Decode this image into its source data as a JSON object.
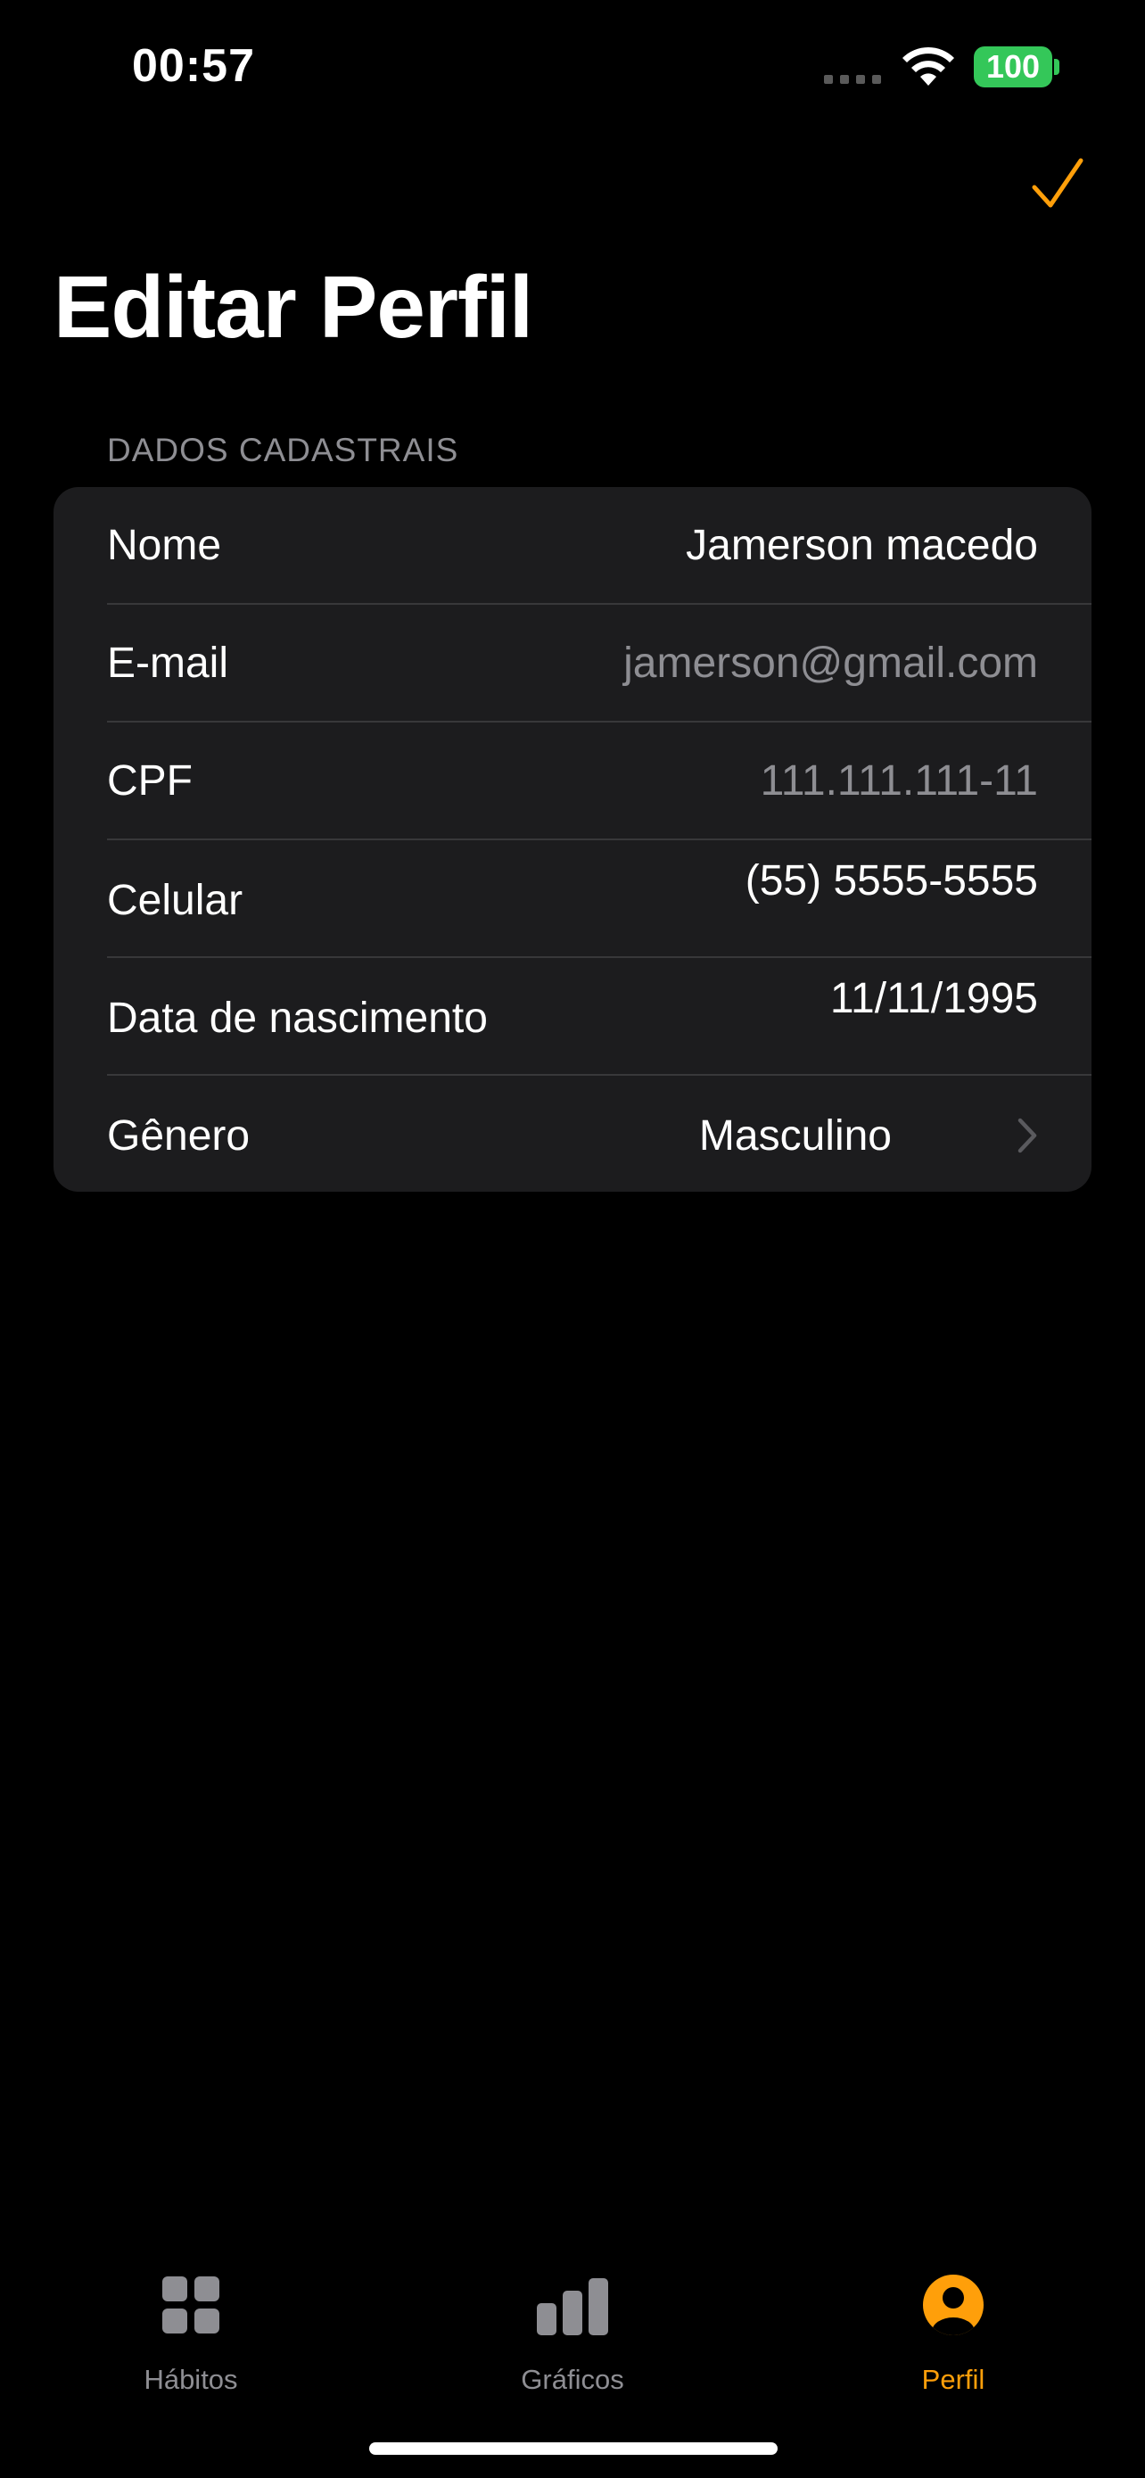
{
  "status_bar": {
    "time": "00:57",
    "battery": "100",
    "battery_color": "#34c759"
  },
  "nav": {
    "done_icon": "checkmark-icon",
    "accent_color": "#ff9f0a",
    "title": "Editar Perfil"
  },
  "section": {
    "header": "DADOS CADASTRAIS",
    "rows": [
      {
        "label": "Nome",
        "value": "Jamerson macedo"
      },
      {
        "label": "E-mail",
        "value": "jamerson@gmail.com"
      },
      {
        "label": "CPF",
        "value": "111.111.111-11"
      },
      {
        "label": "Celular",
        "value": "(55) 5555-5555"
      },
      {
        "label": "Data de nascimento",
        "value": "11/11/1995"
      },
      {
        "label": "Gênero",
        "value": "Masculino"
      }
    ]
  },
  "tabs": [
    {
      "label": "Hábitos",
      "icon": "grid-icon",
      "active": false
    },
    {
      "label": "Gráficos",
      "icon": "bar-chart-icon",
      "active": false
    },
    {
      "label": "Perfil",
      "icon": "person-circle-icon",
      "active": true
    }
  ]
}
